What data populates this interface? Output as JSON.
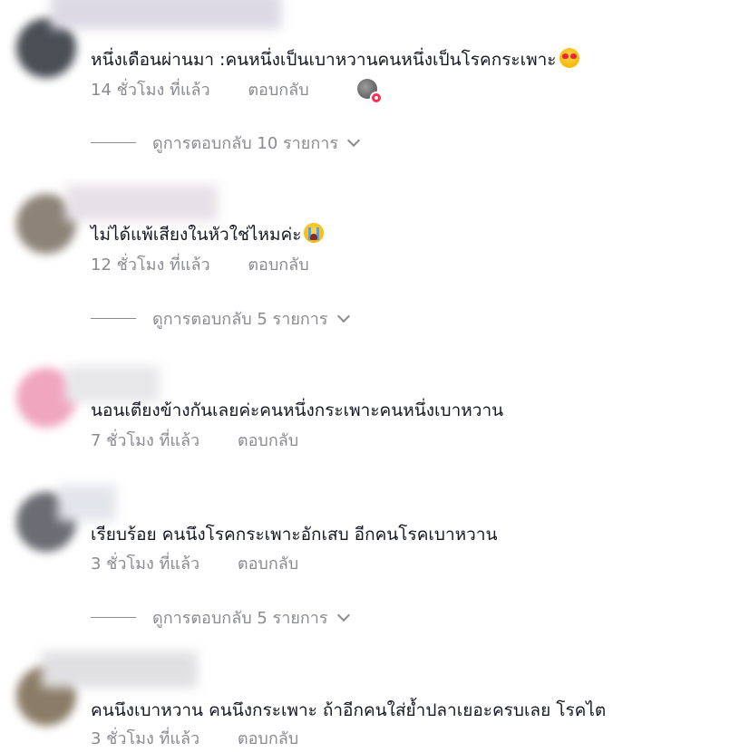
{
  "comments": [
    {
      "text": "หนึ่งเดือนผ่านมา :คนหนึ่งเป็นเบาหวานคนหนึ่งเป็นโรคกระเพาะ",
      "time": "14 ชั่วโมง ที่แล้ว",
      "reply_label": "ตอบกลับ",
      "emoji": "heart-eyes-emoji",
      "view_replies": "ดูการตอบกลับ 10 รายการ"
    },
    {
      "text": "ไม่ได้แพ้เสียงในหัวใช่ไหมค่ะ",
      "time": "12 ชั่วโมง ที่แล้ว",
      "reply_label": "ตอบกลับ",
      "emoji": "crying-emoji",
      "view_replies": "ดูการตอบกลับ 5 รายการ"
    },
    {
      "text": "นอนเตียงข้างกันเลยค่ะคนหนึ่งกระเพาะคนหนึ่งเบาหวาน",
      "time": "7 ชั่วโมง ที่แล้ว",
      "reply_label": "ตอบกลับ"
    },
    {
      "text": "เรียบร้อย คนนึงโรคกระเพาะอักเสบ อีกคนโรคเบาหวาน",
      "time": "3 ชั่วโมง ที่แล้ว",
      "reply_label": "ตอบกลับ",
      "view_replies": "ดูการตอบกลับ 5 รายการ"
    },
    {
      "text": "คนนึงเบาหวาน คนนึงกระเพาะ ถ้าอีกคนใส่ย้ำปลาเยอะครบเลย โรคไต",
      "time": "3 ชั่วโมง ที่แล้ว",
      "reply_label": "ตอบกลับ"
    }
  ],
  "colors": {
    "text": "#161823",
    "secondary": "#8a8b91",
    "like_badge": "#fe2c55"
  }
}
